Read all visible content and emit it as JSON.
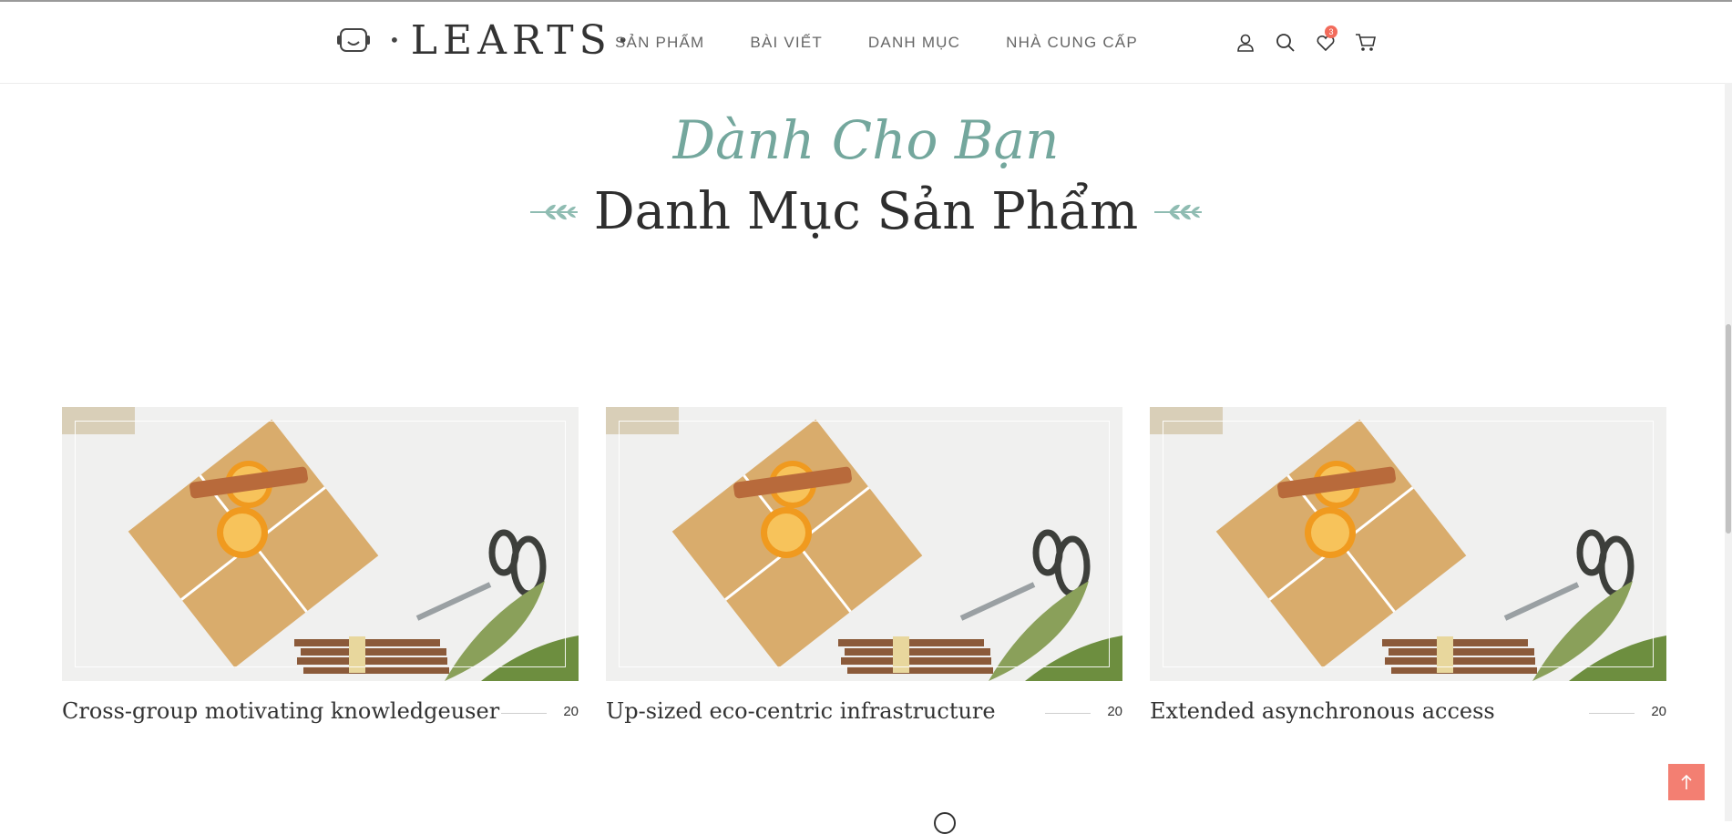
{
  "brand": {
    "name": "LEARTS"
  },
  "nav": {
    "items": [
      "SẢN PHẨM",
      "BÀI VIẾT",
      "DANH MỤC",
      "NHÀ CUNG CẤP"
    ]
  },
  "header_icons": {
    "user": "user-icon",
    "search": "search-icon",
    "wishlist": "heart-icon",
    "wishlist_count": "3",
    "cart": "cart-icon"
  },
  "section": {
    "subtitle": "Dành Cho Bạn",
    "title": "Danh Mục Sản Phẩm"
  },
  "categories": [
    {
      "title": "Cross-group motivating knowledgeuser",
      "count": "20"
    },
    {
      "title": "Up-sized eco-centric infrastructure",
      "count": "20"
    },
    {
      "title": "Extended asynchronous access",
      "count": "20"
    }
  ],
  "colors": {
    "accent": "#74a79d",
    "badge": "#f26b5b",
    "back_to_top": "#f37f72"
  },
  "back_to_top": "arrow-up-icon"
}
